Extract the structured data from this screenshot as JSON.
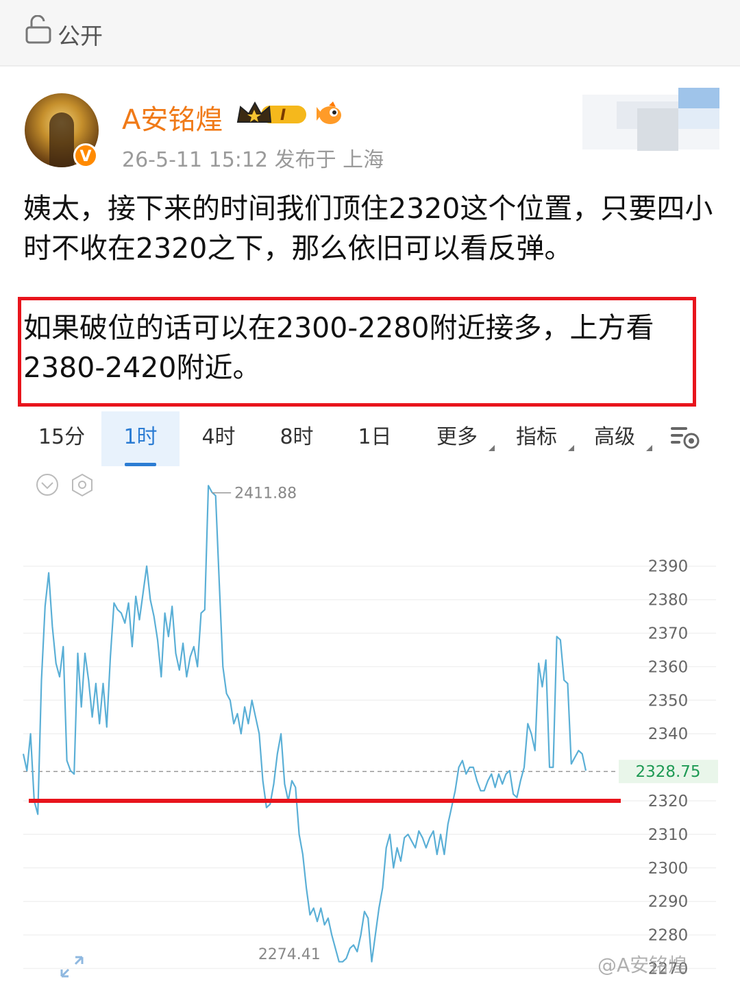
{
  "topbar": {
    "visibility_label": "公开"
  },
  "post": {
    "author": "A安铭煌",
    "verified_badge": "V",
    "level_badge": "I",
    "meta": "26-5-11 15:12  发布于 上海",
    "paragraph1": "姨太，接下来的时间我们顶住2320这个位置，只要四小时不收在2320之下，那么依旧可以看反弹。",
    "paragraph2": "如果破位的话可以在2300-2280附近接多，上方看2380-2420附近。"
  },
  "tabs": [
    {
      "label": "15分"
    },
    {
      "label": "1时"
    },
    {
      "label": "4时"
    },
    {
      "label": "8时"
    },
    {
      "label": "1日"
    },
    {
      "label": "更多"
    },
    {
      "label": "指标"
    },
    {
      "label": "高级"
    }
  ],
  "active_tab": "1时",
  "watermark": "@A安铭煌",
  "chart_data": {
    "type": "line",
    "yticks": [
      2390,
      2380,
      2370,
      2360,
      2350,
      2340,
      2320,
      2310,
      2300,
      2290,
      2280,
      2270
    ],
    "ylim": [
      2268,
      2415
    ],
    "current_price": 2328.75,
    "max_annotation": "2411.88",
    "min_annotation": "2274.41",
    "support_line": 2320,
    "series": [
      {
        "color": "#5aafd6",
        "values": [
          2334,
          2329,
          2340,
          2320,
          2316,
          2356,
          2378,
          2388,
          2372,
          2361,
          2357,
          2366,
          2332,
          2329,
          2328,
          2364,
          2348,
          2364,
          2356,
          2345,
          2355,
          2343,
          2355,
          2342,
          2363,
          2379,
          2377,
          2376,
          2373,
          2379,
          2366,
          2381,
          2374,
          2382,
          2390,
          2380,
          2375,
          2368,
          2357,
          2376,
          2369,
          2378,
          2364,
          2359,
          2367,
          2357,
          2363,
          2366,
          2360,
          2376,
          2377,
          2414,
          2412,
          2411,
          2385,
          2360,
          2352,
          2350,
          2343,
          2346,
          2340,
          2348,
          2343,
          2350,
          2345,
          2340,
          2326,
          2318,
          2319,
          2325,
          2334,
          2340,
          2325,
          2320,
          2326,
          2324,
          2310,
          2304,
          2294,
          2286,
          2288,
          2284,
          2288,
          2283,
          2285,
          2280,
          2276,
          2272,
          2272,
          2273,
          2276,
          2277,
          2275,
          2280,
          2287,
          2285,
          2272,
          2280,
          2288,
          2294,
          2306,
          2310,
          2300,
          2306,
          2302,
          2309,
          2310,
          2308,
          2306,
          2311,
          2309,
          2306,
          2309,
          2311,
          2304,
          2310,
          2304,
          2313,
          2318,
          2323,
          2330,
          2332,
          2328,
          2330,
          2330,
          2326,
          2323,
          2323,
          2326,
          2328,
          2324,
          2328,
          2325,
          2328,
          2329,
          2322,
          2321,
          2326,
          2330,
          2343,
          2340,
          2335,
          2361,
          2354,
          2362,
          2330,
          2330,
          2369,
          2368,
          2356,
          2355,
          2331,
          2333,
          2335,
          2334,
          2329
        ]
      }
    ]
  }
}
